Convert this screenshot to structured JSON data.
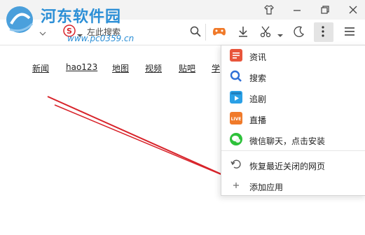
{
  "watermark": {
    "title": "河东软件园",
    "url": "www.pc0359.cn"
  },
  "toolbar": {
    "search_engine_label": "左此搜索"
  },
  "nav_links": [
    "新闻",
    "hao123",
    "地图",
    "视频",
    "贴吧",
    "学"
  ],
  "menu": {
    "items": [
      {
        "label": "资讯",
        "icon": "news-icon",
        "color": "#e8553b"
      },
      {
        "label": "搜索",
        "icon": "search-icon",
        "color": "#2f6fd6"
      },
      {
        "label": "追剧",
        "icon": "video-icon",
        "color": "#2aa0e6"
      },
      {
        "label": "直播",
        "icon": "live-icon",
        "color": "#f07a2a"
      },
      {
        "label": "微信聊天，点击安装",
        "icon": "wechat-icon",
        "color": "#2dc13a"
      },
      {
        "label": "恢复最近关闭的网页",
        "icon": "restore-icon",
        "color": "#555555"
      },
      {
        "label": "添加应用",
        "icon": "plus-icon",
        "color": "#777777"
      }
    ]
  },
  "colors": {
    "accent": "#2c8fd6",
    "arrow": "#d8232a"
  }
}
